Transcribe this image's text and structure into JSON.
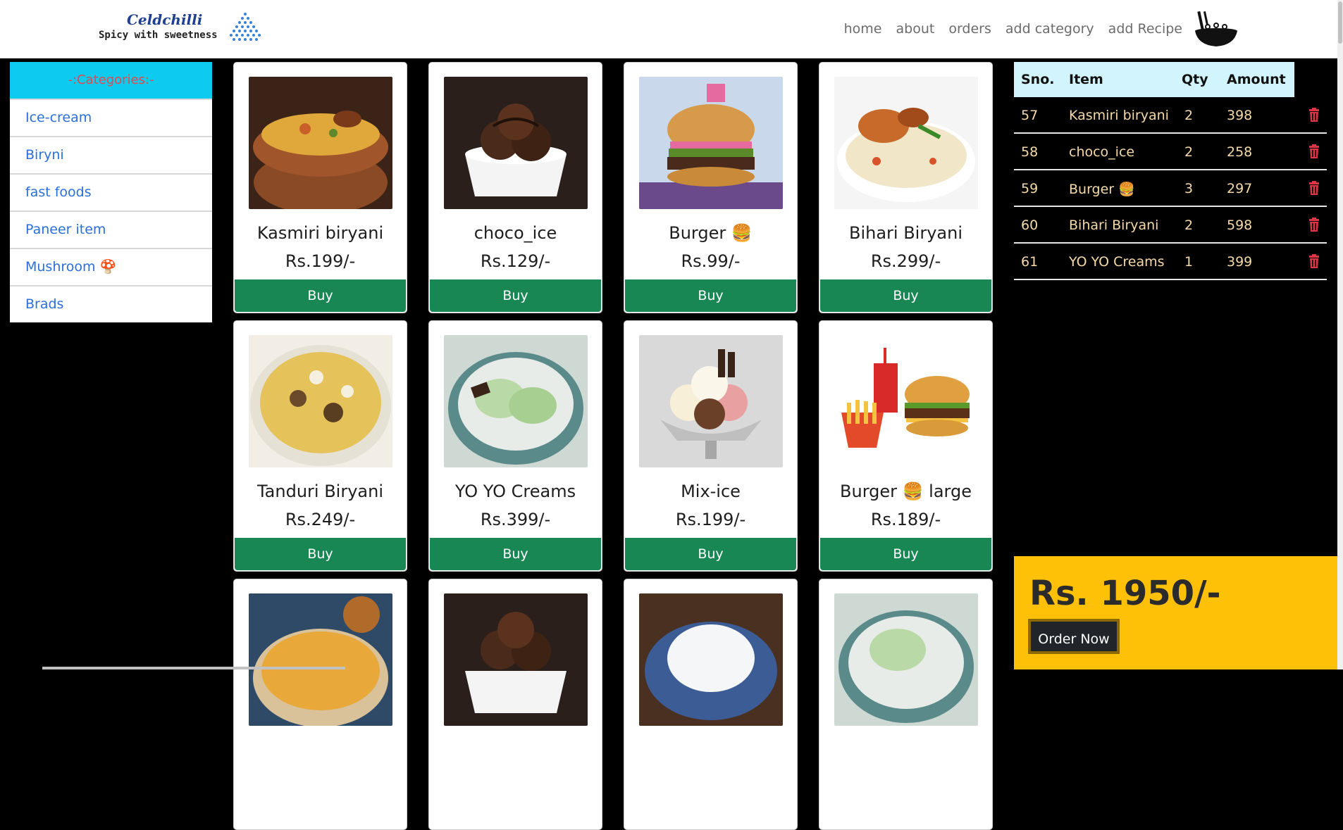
{
  "brand": {
    "name": "Celdchilli",
    "tagline": "Spicy with sweetness"
  },
  "nav": {
    "items": [
      "home",
      "about",
      "orders",
      "add category",
      "add Recipe"
    ]
  },
  "sidebar": {
    "header": "-:Categories:-",
    "items": [
      "Ice-cream",
      "Biryni",
      "fast foods",
      "Paneer item",
      "Mushroom 🍄",
      "Brads"
    ]
  },
  "products": [
    {
      "title": "Kasmiri biryani",
      "price": "Rs.199/-",
      "buy": "Buy",
      "image": "biryani-pot"
    },
    {
      "title": "choco_ice",
      "price": "Rs.129/-",
      "buy": "Buy",
      "image": "chocolate-icecream"
    },
    {
      "title": "Burger 🍔",
      "price": "Rs.99/-",
      "buy": "Buy",
      "image": "burger"
    },
    {
      "title": "Bihari Biryani",
      "price": "Rs.299/-",
      "buy": "Buy",
      "image": "chicken-biryani-plate"
    },
    {
      "title": "Tanduri Biryani",
      "price": "Rs.249/-",
      "buy": "Buy",
      "image": "biryani-plate"
    },
    {
      "title": "YO YO Creams",
      "price": "Rs.399/-",
      "buy": "Buy",
      "image": "pistachio-icecream"
    },
    {
      "title": "Mix-ice",
      "price": "Rs.199/-",
      "buy": "Buy",
      "image": "mixed-icecream-cup"
    },
    {
      "title": "Burger 🍔 large",
      "price": "Rs.189/-",
      "buy": "Buy",
      "image": "burger-combo"
    },
    {
      "title": "",
      "price": "",
      "buy": "",
      "image": "biryani-bowl"
    },
    {
      "title": "",
      "price": "",
      "buy": "",
      "image": "chocolate-icecream"
    },
    {
      "title": "",
      "price": "",
      "buy": "",
      "image": "vanilla-icecream"
    },
    {
      "title": "",
      "price": "",
      "buy": "",
      "image": "pistachio-icecream"
    }
  ],
  "orders": {
    "headers": {
      "sno": "Sno.",
      "item": "Item",
      "qty": "Qty",
      "amount": "Amount"
    },
    "rows": [
      {
        "sno": "57",
        "item": "Kasmiri biryani",
        "qty": "2",
        "amount": "398"
      },
      {
        "sno": "58",
        "item": "choco_ice",
        "qty": "2",
        "amount": "258"
      },
      {
        "sno": "59",
        "item": "Burger 🍔",
        "qty": "3",
        "amount": "297"
      },
      {
        "sno": "60",
        "item": "Bihari Biryani",
        "qty": "2",
        "amount": "598"
      },
      {
        "sno": "61",
        "item": "YO YO Creams",
        "qty": "1",
        "amount": "399"
      }
    ]
  },
  "total": {
    "text": "Rs. 1950/-",
    "order_button": "Order Now"
  },
  "colors": {
    "buy": "#198754",
    "sidebar_header": "#0dcaf0",
    "total_box": "#ffc107",
    "link": "#2a6fdb",
    "trash": "#dc3545"
  }
}
